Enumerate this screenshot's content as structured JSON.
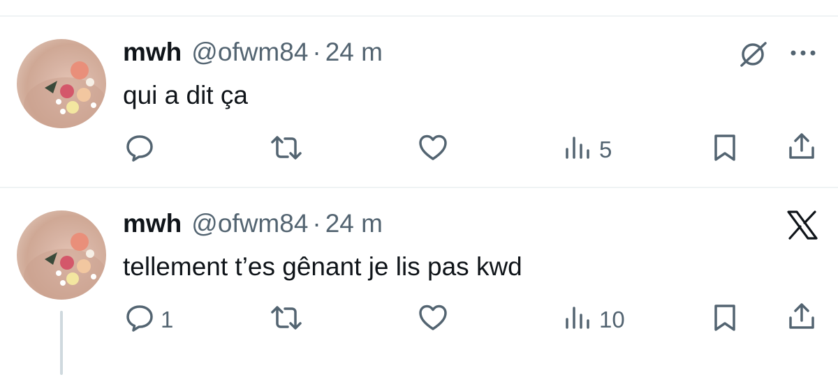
{
  "tweets": [
    {
      "name": "mwh",
      "handle": "@ofwm84",
      "separator": "·",
      "time": "24 m",
      "text": "qui a dit ça",
      "top_right_icons": [
        "grok-icon",
        "more-icon"
      ],
      "replies": "",
      "views": "5"
    },
    {
      "name": "mwh",
      "handle": "@ofwm84",
      "separator": "·",
      "time": "24 m",
      "text": "tellement t’es gênant je lis pas kwd",
      "top_right_icons": [
        "x-logo-icon"
      ],
      "replies": "1",
      "views": "10"
    }
  ],
  "colors": {
    "text": "#0f1419",
    "secondary": "#536471",
    "divider": "#eff3f4"
  }
}
